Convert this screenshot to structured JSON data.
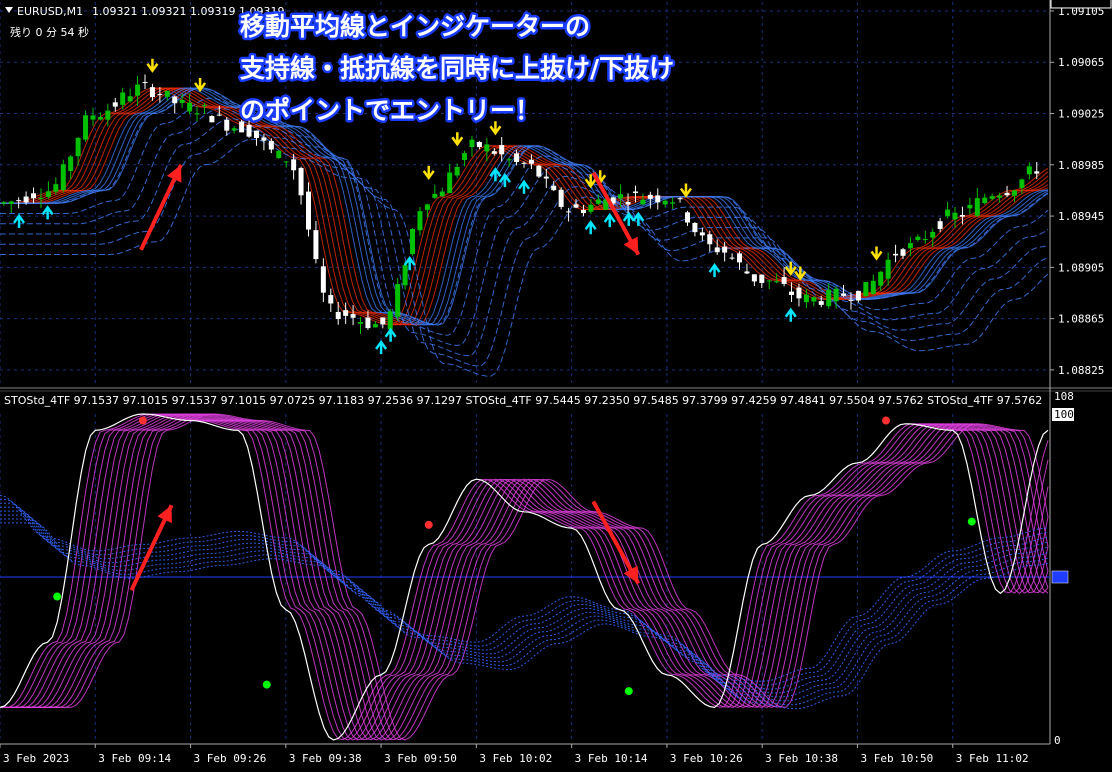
{
  "header": {
    "symbol": "EURUSD,M1",
    "ohlc": "1.09321 1.09321 1.09319 1.09319",
    "countdown": "残り  0 分  54 秒"
  },
  "title_lines": [
    "移動平均線とインジケーターの",
    "支持線・抵抗線を同時に上抜け/下抜け",
    "のポイントでエントリー！"
  ],
  "indicator_header": "STOStd_4TF 97.1537 97.1015 97.1537 97.1015 97.0725 97.1183 97.2536 97.1297  STOStd_4TF 97.5445 97.2350 97.5485 97.3799 97.4259 97.4841 97.5504 97.5762  STOStd_4TF 97.5762",
  "colors": {
    "background": "#000000",
    "grid": "#1a2f7a",
    "bull": "#00c000",
    "bear": "#ffffff",
    "ma_red": "#ff3000",
    "ma_blue": "#4080ff",
    "stoch_main": "#ffffff",
    "stoch_ribbon": "#e040e0",
    "stoch_slow": "#3366ff",
    "arrow_up": "#00e5ff",
    "arrow_down": "#ffe000",
    "annotation": "#ff2020"
  },
  "chart_data": [
    {
      "type": "line",
      "name": "price",
      "series_name": "EURUSD,M1",
      "ylim": [
        1.08814,
        1.09112
      ],
      "yticks": [
        "1.09105",
        "1.09065",
        "1.09025",
        "1.08985",
        "1.08945",
        "1.08905",
        "1.08865",
        "1.08825"
      ],
      "y_values": [
        1.09105,
        1.09065,
        1.09025,
        1.08985,
        1.08945,
        1.08905,
        1.08865,
        1.08825
      ],
      "last_price": "1.09319",
      "x": [
        0,
        5,
        10,
        15,
        20,
        25,
        30,
        35,
        40,
        45,
        50,
        55,
        60,
        65,
        70,
        75,
        80,
        85,
        90,
        95,
        100,
        105,
        110
      ],
      "y": [
        1.08955,
        1.08965,
        1.09025,
        1.09045,
        1.0903,
        1.09015,
        1.0899,
        1.0887,
        1.0886,
        1.0896,
        1.09,
        1.08985,
        1.0895,
        1.0896,
        1.0896,
        1.0892,
        1.08895,
        1.0888,
        1.08885,
        1.0892,
        1.08945,
        1.08965,
        1.08985
      ]
    },
    {
      "type": "line",
      "name": "stochastic",
      "ylim": [
        0,
        100
      ],
      "yticks": [
        "100",
        "0"
      ],
      "y_values": [
        100,
        0
      ],
      "top_tick": "108",
      "series": [
        {
          "values": [
            10,
            30,
            95,
            100,
            98,
            95,
            40,
            0,
            20,
            60,
            80,
            70,
            65,
            40,
            20,
            10,
            60,
            75,
            85,
            97,
            95,
            45,
            95
          ]
        },
        {
          "values": [
            75,
            62,
            58,
            60,
            62,
            64,
            62,
            52,
            40,
            32,
            30,
            38,
            44,
            40,
            32,
            20,
            18,
            22,
            38,
            50,
            58,
            62,
            65
          ]
        }
      ],
      "x": [
        0,
        5,
        10,
        15,
        20,
        25,
        30,
        35,
        40,
        45,
        50,
        55,
        60,
        65,
        70,
        75,
        80,
        85,
        90,
        95,
        100,
        105,
        110
      ],
      "dots": [
        {
          "x": 6,
          "value": 44,
          "color": "#00ff00"
        },
        {
          "x": 15,
          "value": 98,
          "color": "#ff3030"
        },
        {
          "x": 28,
          "value": 17,
          "color": "#00ff00"
        },
        {
          "x": 45,
          "value": 66,
          "color": "#ff3030"
        },
        {
          "x": 66,
          "value": 15,
          "color": "#00ff00"
        },
        {
          "x": 93,
          "value": 98,
          "color": "#ff3030"
        },
        {
          "x": 102,
          "value": 67,
          "color": "#00ff00"
        }
      ],
      "level": 50
    }
  ],
  "time_axis": [
    "3 Feb 2023",
    "3 Feb 09:14",
    "3 Feb 09:26",
    "3 Feb 09:38",
    "3 Feb 09:50",
    "3 Feb 10:02",
    "3 Feb 10:14",
    "3 Feb 10:26",
    "3 Feb 10:38",
    "3 Feb 10:50",
    "3 Feb 11:02"
  ],
  "time_axis_x": [
    0,
    10,
    20,
    30,
    40,
    50,
    60,
    70,
    80,
    90,
    100
  ],
  "annotations": [
    {
      "pane": "price",
      "direction": "up",
      "x": 19,
      "value": 1.08985
    },
    {
      "pane": "price",
      "direction": "down",
      "x": 67,
      "value": 1.08915
    },
    {
      "pane": "stochastic",
      "direction": "up",
      "x": 18,
      "value": 72
    },
    {
      "pane": "stochastic",
      "direction": "down",
      "x": 67,
      "value": 48
    }
  ]
}
